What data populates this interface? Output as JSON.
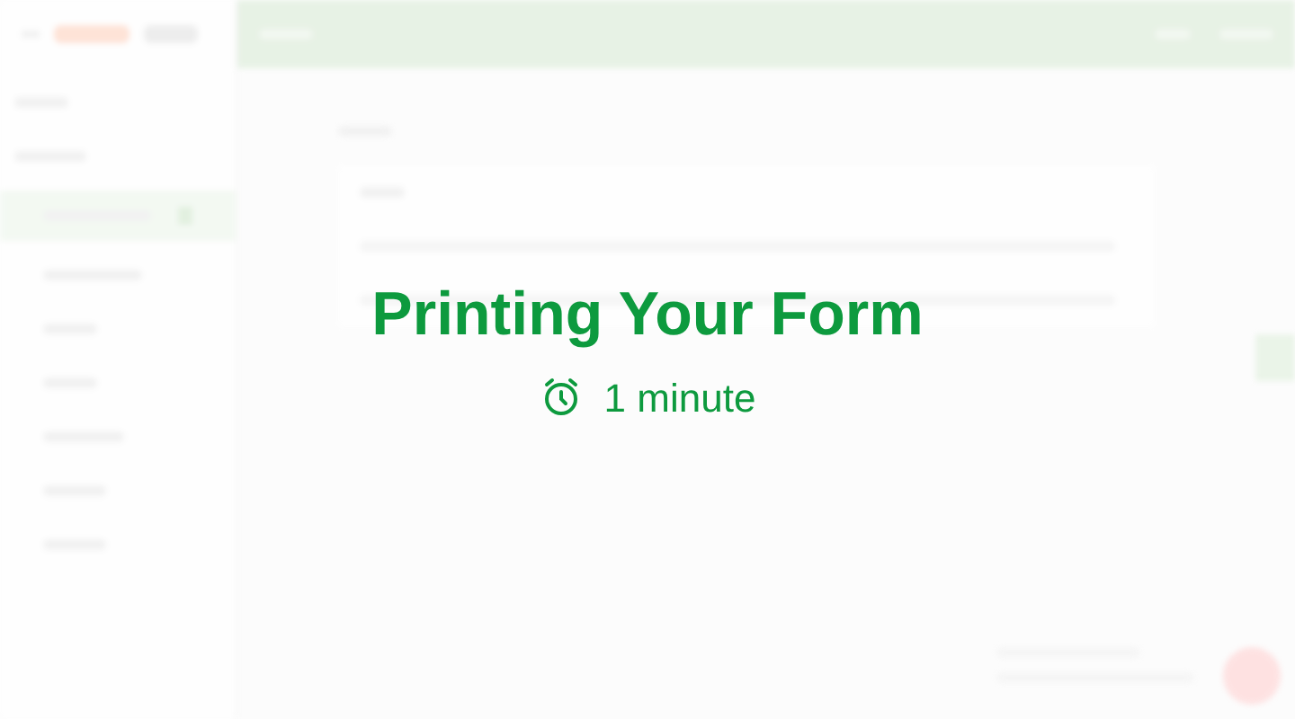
{
  "overlay": {
    "title": "Printing Your Form",
    "duration": "1 minute"
  }
}
